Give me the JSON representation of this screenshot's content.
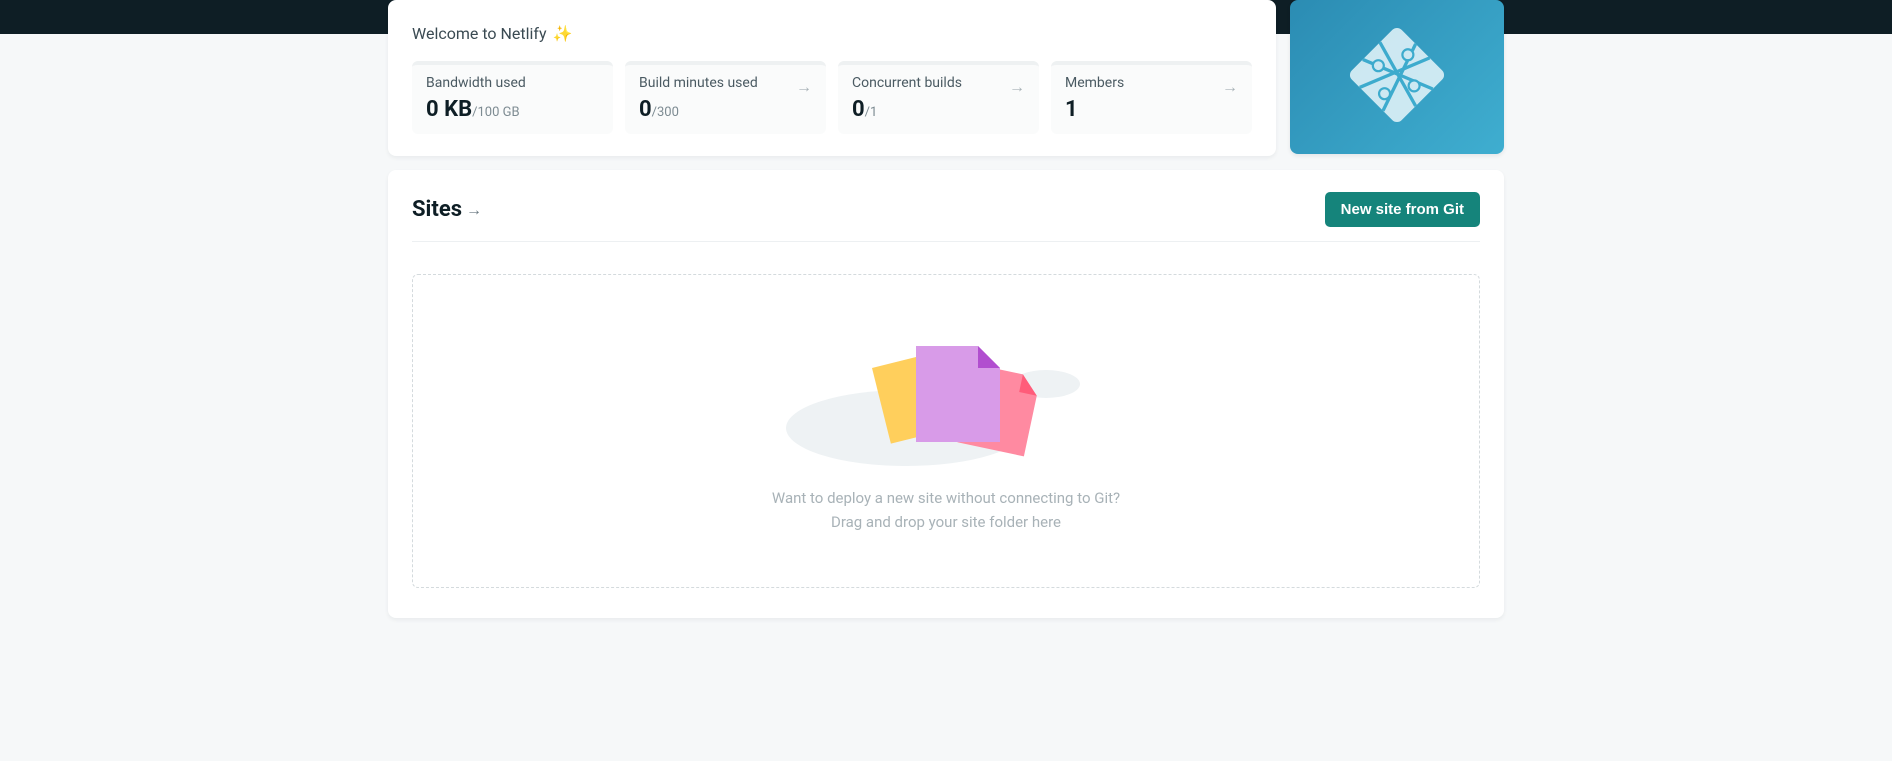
{
  "welcome": {
    "text": "Welcome to Netlify"
  },
  "stats": {
    "bandwidth": {
      "label": "Bandwidth used",
      "value": "0 KB",
      "suffix": "/100 GB"
    },
    "build_minutes": {
      "label": "Build minutes used",
      "value": "0",
      "suffix": "/300"
    },
    "concurrent_builds": {
      "label": "Concurrent builds",
      "value": "0",
      "suffix": "/1"
    },
    "members": {
      "label": "Members",
      "value": "1",
      "suffix": ""
    }
  },
  "sites": {
    "title": "Sites",
    "new_site_button": "New site from Git",
    "dropzone": {
      "line1": "Want to deploy a new site without connecting to Git?",
      "line2": "Drag and drop your site folder here"
    }
  },
  "colors": {
    "accent": "#15847b",
    "brand_gradient_from": "#2b8cb3",
    "brand_gradient_to": "#3faed0"
  }
}
